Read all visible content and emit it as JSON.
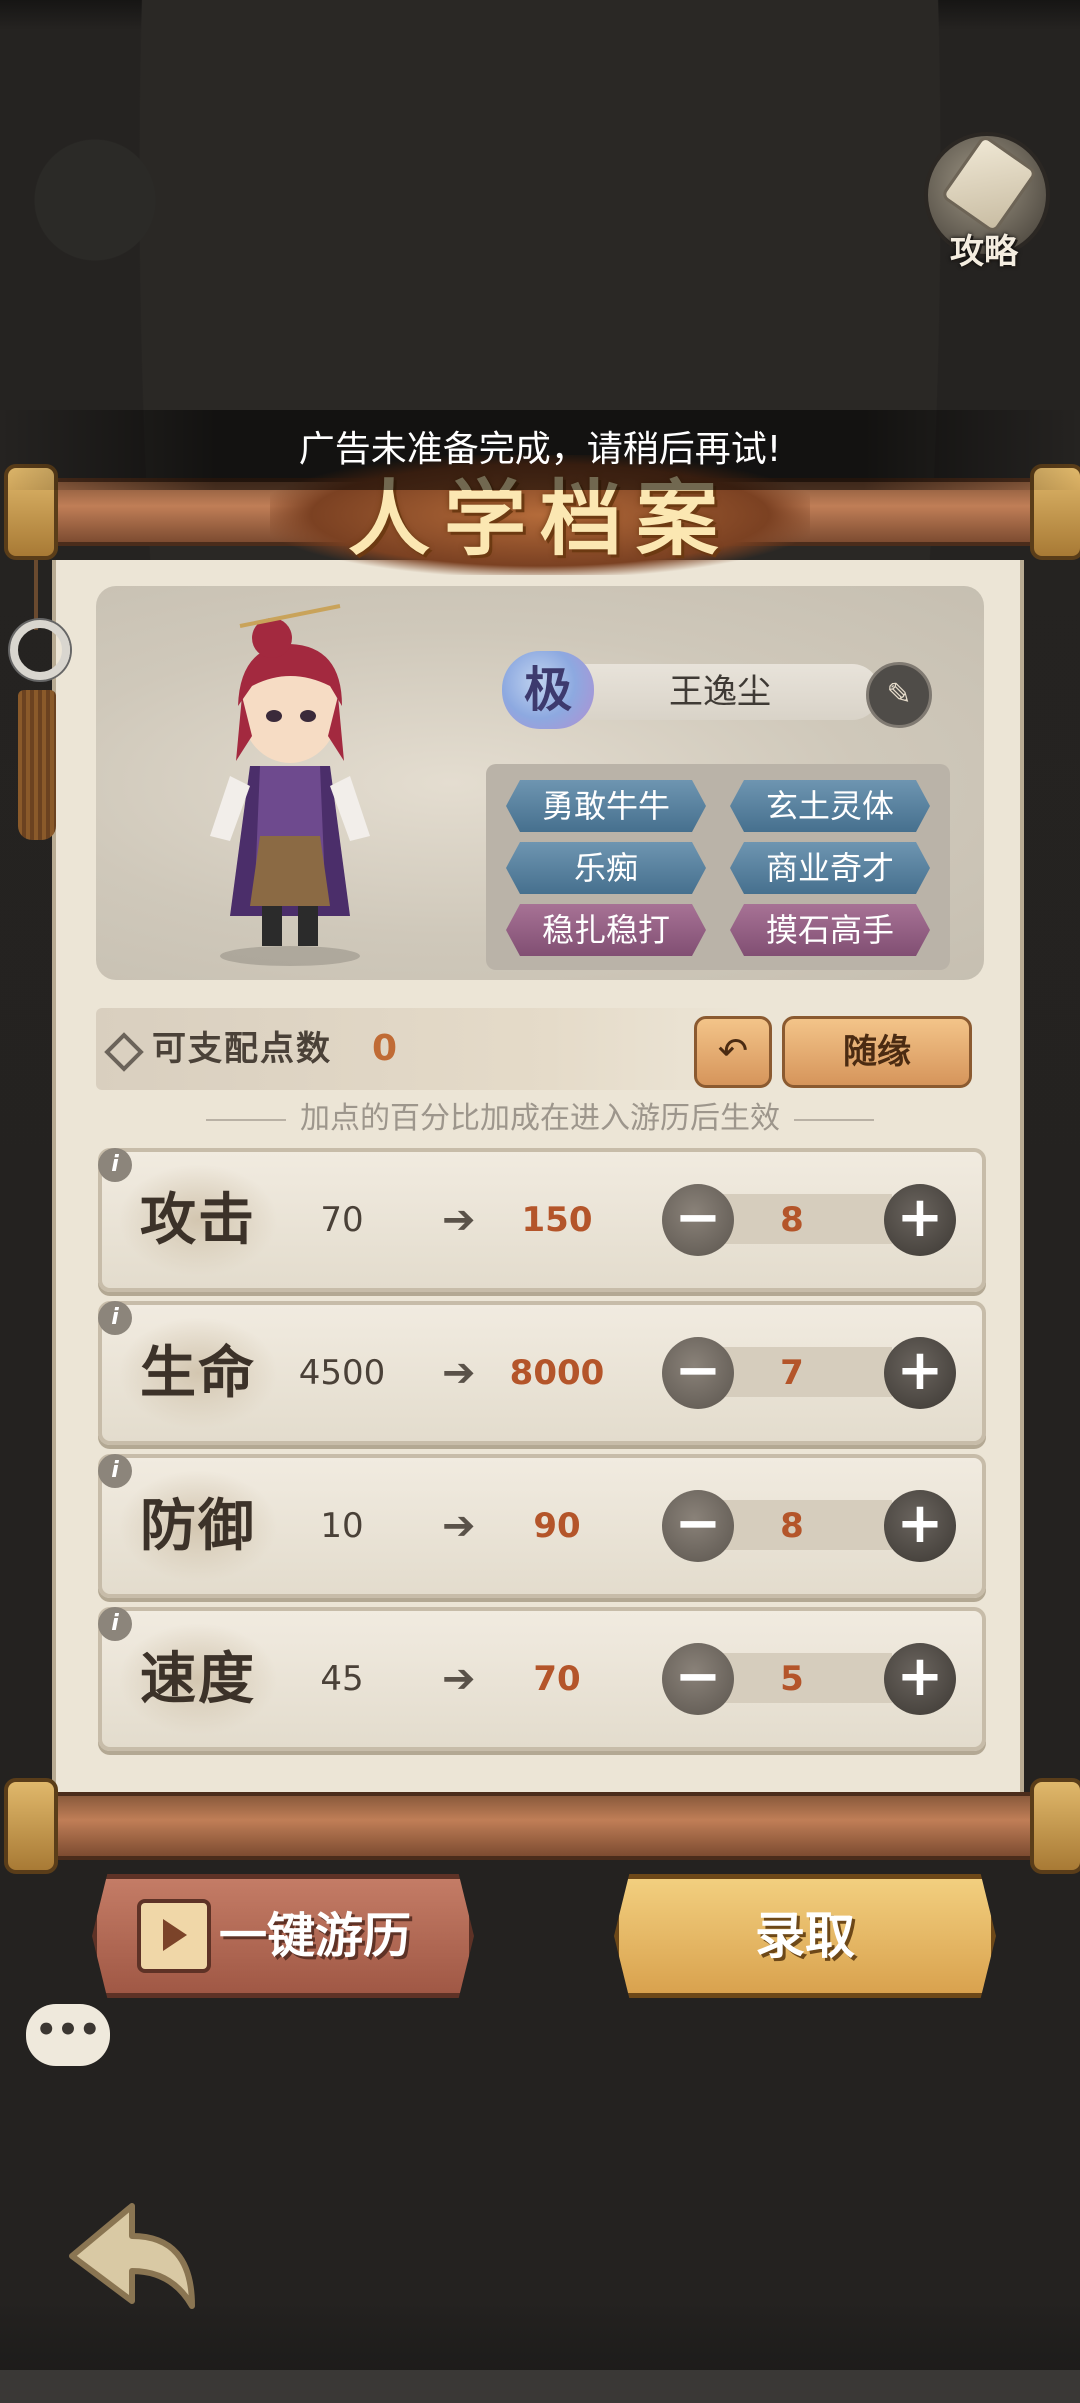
{
  "guide": {
    "label": "攻略",
    "icon": "scroll-icon"
  },
  "toast": "广告未准备完成，请稍后再试!",
  "title": "人学档案",
  "character": {
    "rank": "极",
    "name": "王逸尘",
    "traits": [
      {
        "label": "勇敢牛牛",
        "color": "#5a84a3"
      },
      {
        "label": "玄土灵体",
        "color": "#5a84a3"
      },
      {
        "label": "乐痴",
        "color": "#5a84a3"
      },
      {
        "label": "商业奇才",
        "color": "#5a84a3"
      },
      {
        "label": "稳扎稳打",
        "color": "#94618a"
      },
      {
        "label": "摸石高手",
        "color": "#94618a"
      }
    ]
  },
  "points": {
    "label": "可支配点数",
    "value": "0",
    "random_label": "随缘"
  },
  "hint": "加点的百分比加成在进入游历后生效",
  "stats": [
    {
      "name": "攻击",
      "base": "70",
      "result": "150",
      "allocated": "8"
    },
    {
      "name": "生命",
      "base": "4500",
      "result": "8000",
      "allocated": "7"
    },
    {
      "name": "防御",
      "base": "10",
      "result": "90",
      "allocated": "8"
    },
    {
      "name": "速度",
      "base": "45",
      "result": "70",
      "allocated": "5"
    }
  ],
  "buttons": {
    "travel": "一键游历",
    "admit": "录取"
  },
  "controls": {
    "minus": "−",
    "plus": "+",
    "info": "i",
    "undo": "↶",
    "arrow": "➔",
    "chat": "•••"
  }
}
